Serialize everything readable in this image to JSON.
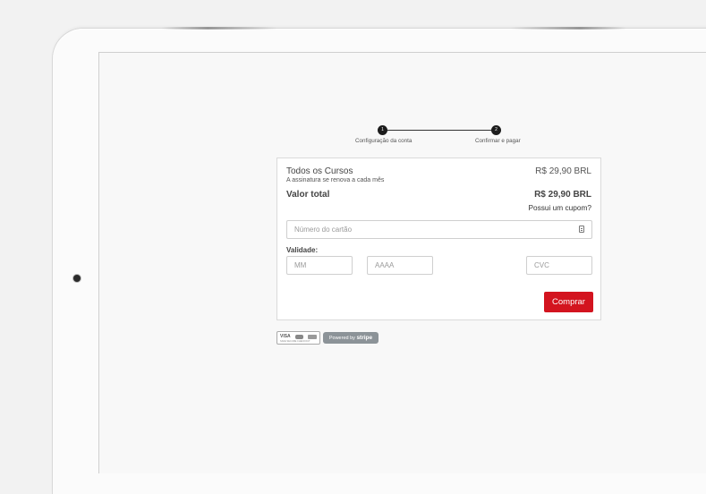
{
  "stepper": {
    "steps": [
      {
        "number": "1",
        "label": "Configuração da conta"
      },
      {
        "number": "2",
        "label": "Confirmar e pagar"
      }
    ]
  },
  "order": {
    "course_name": "Todos os Cursos",
    "subscription_note": "A assinatura se renova a cada mês",
    "course_price": "R$ 29,90 BRL",
    "total_label": "Valor total",
    "total_price": "R$ 29,90 BRL",
    "coupon_link": "Possui um cupom?"
  },
  "payment": {
    "card_number_placeholder": "Número do cartão",
    "validity_label": "Validade:",
    "month_placeholder": "MM",
    "year_placeholder": "AAAA",
    "cvc_placeholder": "CVC",
    "buy_label": "Comprar"
  },
  "badges": {
    "card_brands": "VISA",
    "secure_text": "SAFE SECURE CHECKOUT",
    "stripe_prefix": "Powered by",
    "stripe_word": "stripe"
  },
  "colors": {
    "accent": "#d3141f",
    "stripe_badge": "#8c9398"
  }
}
